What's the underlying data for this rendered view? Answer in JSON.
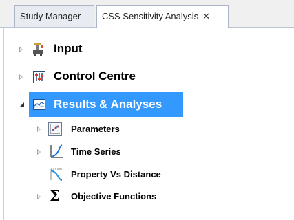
{
  "tabs": [
    {
      "label": "Study Manager",
      "active": false
    },
    {
      "label": "CSS Sensitivity Analysis",
      "active": true,
      "close": "✕"
    }
  ],
  "tree": {
    "input": {
      "label": "Input",
      "icon": "input-tool-icon",
      "state": "collapsed"
    },
    "control_centre": {
      "label": "Control Centre",
      "icon": "control-centre-icon",
      "state": "collapsed"
    },
    "results": {
      "label": "Results & Analyses",
      "icon": "chart-icon",
      "state": "expanded",
      "selected": true,
      "children": [
        {
          "label": "Parameters",
          "icon": "parameters-chart-icon",
          "state": "collapsed"
        },
        {
          "label": "Time Series",
          "icon": "time-series-icon",
          "state": "collapsed"
        },
        {
          "label": "Property Vs Distance",
          "icon": "property-distance-icon",
          "state": "leaf"
        },
        {
          "label": "Objective Functions",
          "icon": "sigma-icon",
          "state": "collapsed"
        }
      ]
    }
  },
  "colors": {
    "selection": "#3399ff",
    "tab_border": "#aab6c6"
  }
}
